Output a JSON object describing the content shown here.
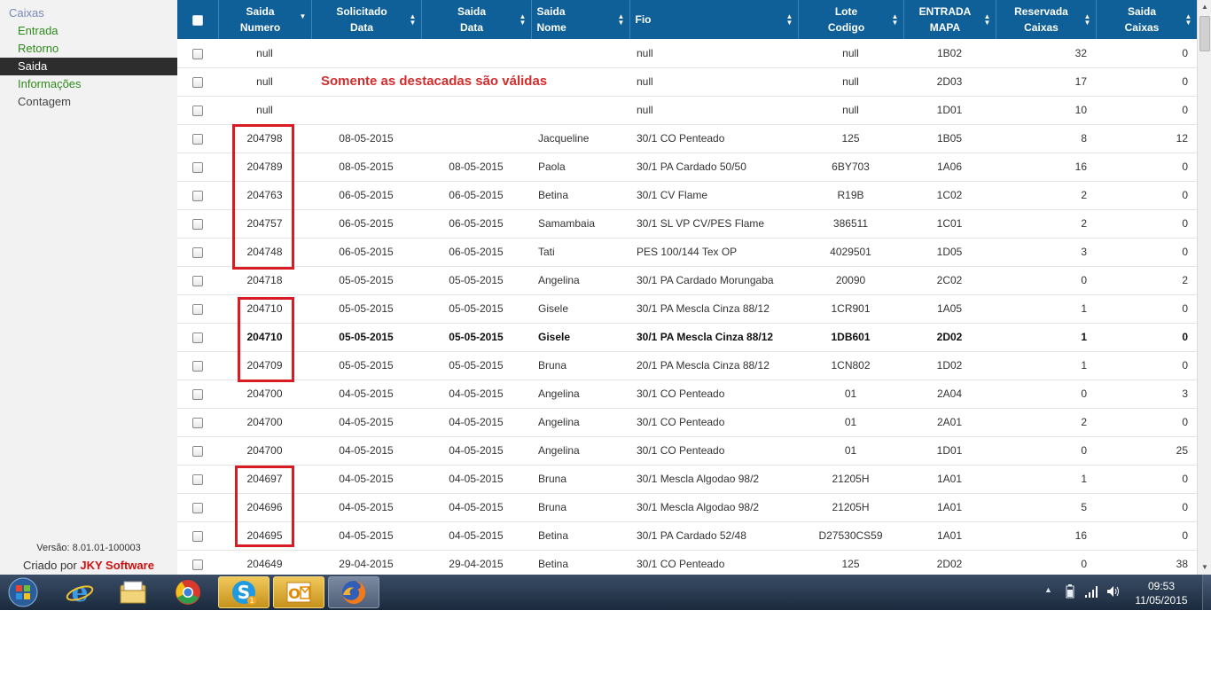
{
  "sidebar": {
    "title": "Caixas",
    "items": [
      {
        "label": "Entrada"
      },
      {
        "label": "Retorno"
      },
      {
        "label": "Saida"
      },
      {
        "label": "Informações"
      },
      {
        "label": "Contagem"
      }
    ],
    "version": "Versão: 8.01.01-100003",
    "credit_prefix": "Criado por",
    "credit_brand": "JKY Software"
  },
  "table": {
    "headers": [
      {
        "line1": "Saida",
        "line2": "Numero",
        "sort": "desc"
      },
      {
        "line1": "Solicitado",
        "line2": "Data",
        "sort": "both"
      },
      {
        "line1": "Saida",
        "line2": "Data",
        "sort": "both"
      },
      {
        "line1": "Saida",
        "line2": "Nome",
        "sort": "both"
      },
      {
        "line1": "Fio",
        "line2": "",
        "sort": "both"
      },
      {
        "line1": "Lote",
        "line2": "Codigo",
        "sort": "both"
      },
      {
        "line1": "ENTRADA",
        "line2": "MAPA",
        "sort": "both"
      },
      {
        "line1": "Reservada",
        "line2": "Caixas",
        "sort": "both"
      },
      {
        "line1": "Saida",
        "line2": "Caixas",
        "sort": "both"
      }
    ],
    "rows": [
      {
        "numero": "null",
        "solicitado": "",
        "saida_data": "",
        "nome": "",
        "fio": "null",
        "lote": "null",
        "mapa": "1B02",
        "reservada": "32",
        "saida_caixas": "0"
      },
      {
        "numero": "null",
        "solicitado": "",
        "saida_data": "",
        "nome": "",
        "fio": "null",
        "lote": "null",
        "mapa": "2D03",
        "reservada": "17",
        "saida_caixas": "0"
      },
      {
        "numero": "null",
        "solicitado": "",
        "saida_data": "",
        "nome": "",
        "fio": "null",
        "lote": "null",
        "mapa": "1D01",
        "reservada": "10",
        "saida_caixas": "0"
      },
      {
        "numero": "204798",
        "solicitado": "08-05-2015",
        "saida_data": "",
        "nome": "Jacqueline",
        "fio": "30/1 CO Penteado",
        "lote": "125",
        "mapa": "1B05",
        "reservada": "8",
        "saida_caixas": "12"
      },
      {
        "numero": "204789",
        "solicitado": "08-05-2015",
        "saida_data": "08-05-2015",
        "nome": "Paola",
        "fio": "30/1 PA Cardado 50/50",
        "lote": "6BY703",
        "mapa": "1A06",
        "reservada": "16",
        "saida_caixas": "0"
      },
      {
        "numero": "204763",
        "solicitado": "06-05-2015",
        "saida_data": "06-05-2015",
        "nome": "Betina",
        "fio": "30/1 CV Flame",
        "lote": "R19B",
        "mapa": "1C02",
        "reservada": "2",
        "saida_caixas": "0"
      },
      {
        "numero": "204757",
        "solicitado": "06-05-2015",
        "saida_data": "06-05-2015",
        "nome": "Samambaia",
        "fio": "30/1 SL VP CV/PES Flame",
        "lote": "386511",
        "mapa": "1C01",
        "reservada": "2",
        "saida_caixas": "0"
      },
      {
        "numero": "204748",
        "solicitado": "06-05-2015",
        "saida_data": "06-05-2015",
        "nome": "Tati",
        "fio": "PES 100/144 Tex OP",
        "lote": "4029501",
        "mapa": "1D05",
        "reservada": "3",
        "saida_caixas": "0"
      },
      {
        "numero": "204718",
        "solicitado": "05-05-2015",
        "saida_data": "05-05-2015",
        "nome": "Angelina",
        "fio": "30/1 PA Cardado Morungaba",
        "lote": "20090",
        "mapa": "2C02",
        "reservada": "0",
        "saida_caixas": "2"
      },
      {
        "numero": "204710",
        "solicitado": "05-05-2015",
        "saida_data": "05-05-2015",
        "nome": "Gisele",
        "fio": "30/1 PA Mescla Cinza 88/12",
        "lote": "1CR901",
        "mapa": "1A05",
        "reservada": "1",
        "saida_caixas": "0"
      },
      {
        "numero": "204710",
        "solicitado": "05-05-2015",
        "saida_data": "05-05-2015",
        "nome": "Gisele",
        "fio": "30/1 PA Mescla Cinza 88/12",
        "lote": "1DB601",
        "mapa": "2D02",
        "reservada": "1",
        "saida_caixas": "0"
      },
      {
        "numero": "204709",
        "solicitado": "05-05-2015",
        "saida_data": "05-05-2015",
        "nome": "Bruna",
        "fio": "20/1 PA Mescla Cinza 88/12",
        "lote": "1CN802",
        "mapa": "1D02",
        "reservada": "1",
        "saida_caixas": "0"
      },
      {
        "numero": "204700",
        "solicitado": "04-05-2015",
        "saida_data": "04-05-2015",
        "nome": "Angelina",
        "fio": "30/1 CO Penteado",
        "lote": "01",
        "mapa": "2A04",
        "reservada": "0",
        "saida_caixas": "3"
      },
      {
        "numero": "204700",
        "solicitado": "04-05-2015",
        "saida_data": "04-05-2015",
        "nome": "Angelina",
        "fio": "30/1 CO Penteado",
        "lote": "01",
        "mapa": "2A01",
        "reservada": "2",
        "saida_caixas": "0"
      },
      {
        "numero": "204700",
        "solicitado": "04-05-2015",
        "saida_data": "04-05-2015",
        "nome": "Angelina",
        "fio": "30/1 CO Penteado",
        "lote": "01",
        "mapa": "1D01",
        "reservada": "0",
        "saida_caixas": "25"
      },
      {
        "numero": "204697",
        "solicitado": "04-05-2015",
        "saida_data": "04-05-2015",
        "nome": "Bruna",
        "fio": "30/1 Mescla Algodao 98/2",
        "lote": "21205H",
        "mapa": "1A01",
        "reservada": "1",
        "saida_caixas": "0"
      },
      {
        "numero": "204696",
        "solicitado": "04-05-2015",
        "saida_data": "04-05-2015",
        "nome": "Bruna",
        "fio": "30/1 Mescla Algodao 98/2",
        "lote": "21205H",
        "mapa": "1A01",
        "reservada": "5",
        "saida_caixas": "0"
      },
      {
        "numero": "204695",
        "solicitado": "04-05-2015",
        "saida_data": "04-05-2015",
        "nome": "Betina",
        "fio": "30/1 PA Cardado 52/48",
        "lote": "D27530CS59",
        "mapa": "1A01",
        "reservada": "16",
        "saida_caixas": "0"
      },
      {
        "numero": "204649",
        "solicitado": "29-04-2015",
        "saida_data": "29-04-2015",
        "nome": "Betina",
        "fio": "30/1 CO Penteado",
        "lote": "125",
        "mapa": "2D02",
        "reservada": "0",
        "saida_caixas": "38"
      }
    ]
  },
  "annotation": {
    "note": "Somente as destacadas são válidas",
    "color": "#d91b24"
  },
  "taskbar": {
    "apps": [
      "windows-start",
      "internet-explorer",
      "file-explorer",
      "chrome",
      "skype",
      "outlook",
      "firefox"
    ],
    "skype_badge": "1",
    "time": "09:53",
    "date": "11/05/2015"
  },
  "colors": {
    "header_bg": "#0f5f98",
    "nav_active_bg": "#2d2d2d",
    "nav_link": "#2e8b1d",
    "brand": "#cc1111"
  }
}
